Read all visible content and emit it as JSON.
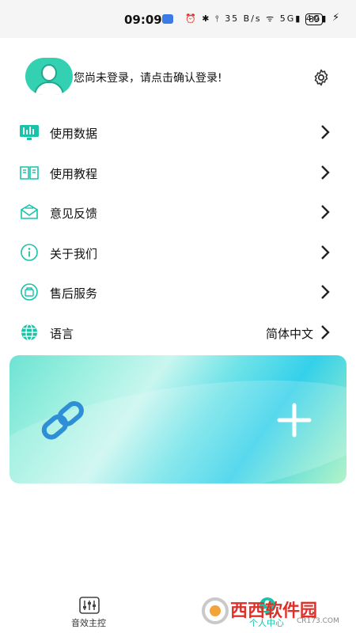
{
  "status_bar": {
    "time": "09:09",
    "indicators": "⏰ ✱ ⫯ 35 B/s ᯤ 5G▮ 4G▮",
    "battery": "89"
  },
  "profile": {
    "login_prompt": "您尚未登录，请点击确认登录!",
    "avatar_icon": "user-avatar-icon",
    "settings_icon": "gear-icon"
  },
  "menu": {
    "items": [
      {
        "label": "使用数据",
        "icon": "usage-data-icon"
      },
      {
        "label": "使用教程",
        "icon": "tutorial-book-icon"
      },
      {
        "label": "意见反馈",
        "icon": "feedback-mail-icon"
      },
      {
        "label": "关于我们",
        "icon": "info-icon"
      },
      {
        "label": "售后服务",
        "icon": "after-sales-icon"
      },
      {
        "label": "语言",
        "icon": "globe-icon",
        "value": "简体中文"
      }
    ]
  },
  "connect_card": {
    "link_icon": "link-icon",
    "add_icon": "plus-icon"
  },
  "tabbar": {
    "tabs": [
      {
        "label": "音效主控",
        "icon": "equalizer-icon"
      },
      {
        "label": "个人中心",
        "icon": "person-icon"
      }
    ]
  },
  "watermark": {
    "text": "西西软件园",
    "sub": "CR173.COM"
  },
  "colors": {
    "accent": "#18c3a8",
    "card_gradient_start": "#6ee3d3",
    "card_gradient_mid": "#34d0ea",
    "card_gradient_end": "#b4f3c9",
    "link_icon": "#2f8fd6"
  }
}
